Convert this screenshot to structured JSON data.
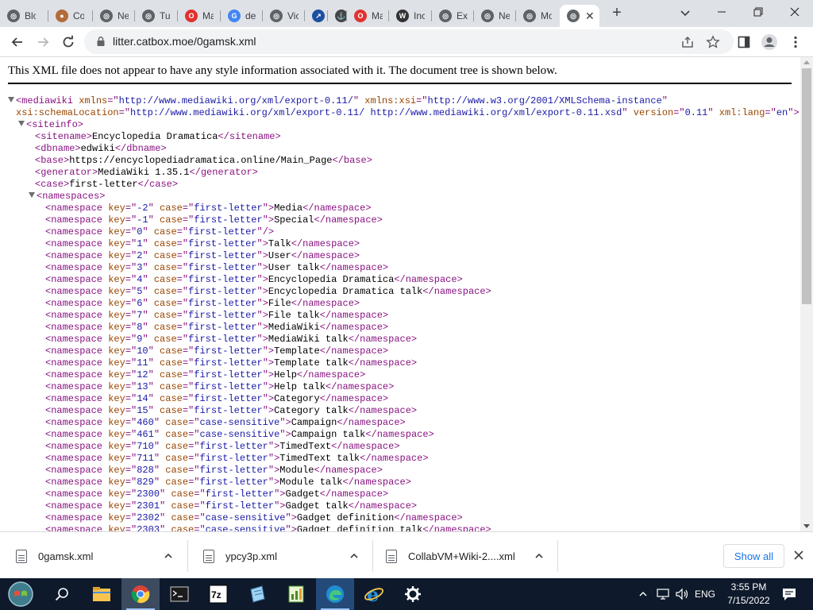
{
  "browser": {
    "tabs": [
      {
        "title": "Blc",
        "icon": "globe-icon"
      },
      {
        "title": "Co",
        "icon": "avatar-icon"
      },
      {
        "title": "Ne",
        "icon": "globe-icon"
      },
      {
        "title": "Tu",
        "icon": "globe-icon"
      },
      {
        "title": "Ma",
        "icon": "opera-red-icon"
      },
      {
        "title": "de",
        "icon": "google-icon"
      },
      {
        "title": "Vic",
        "icon": "globe-icon"
      },
      {
        "title": "",
        "icon": "bird-icon"
      },
      {
        "title": "",
        "icon": "anchor-icon"
      },
      {
        "title": "Ma",
        "icon": "opera-red-icon"
      },
      {
        "title": "Inc",
        "icon": "wikipedia-icon"
      },
      {
        "title": "Ex",
        "icon": "globe-icon"
      },
      {
        "title": "Ne",
        "icon": "globe-icon"
      },
      {
        "title": "Mo",
        "icon": "globe-icon"
      },
      {
        "title": "",
        "icon": "globe-icon",
        "active": true
      }
    ],
    "new_tab": "+",
    "url": "litter.catbox.moe/0gamsk.xml"
  },
  "page": {
    "notice": "This XML file does not appear to have any style information associated with it. The document tree is shown below.",
    "xml_lines": [
      {
        "indent": 0,
        "toggle": true,
        "parts": [
          [
            "tg",
            "<mediawiki"
          ],
          [
            "tx",
            " "
          ],
          [
            "an",
            "xmlns"
          ],
          [
            "tg",
            "=\""
          ],
          [
            "av",
            "http://www.mediawiki.org/xml/export-0.11/"
          ],
          [
            "tg",
            "\""
          ],
          [
            "tx",
            " "
          ],
          [
            "an",
            "xmlns:xsi"
          ],
          [
            "tg",
            "=\""
          ],
          [
            "av",
            "http://www.w3.org/2001/XMLSchema-instance"
          ],
          [
            "tg",
            "\""
          ]
        ]
      },
      {
        "indent": 0,
        "toggle": false,
        "offset": 20,
        "parts": [
          [
            "an",
            "xsi:schemaLocation"
          ],
          [
            "tg",
            "=\""
          ],
          [
            "av",
            "http://www.mediawiki.org/xml/export-0.11/ http://www.mediawiki.org/xml/export-0.11.xsd"
          ],
          [
            "tg",
            "\""
          ],
          [
            "tx",
            " "
          ],
          [
            "an",
            "version"
          ],
          [
            "tg",
            "=\""
          ],
          [
            "av",
            "0.11"
          ],
          [
            "tg",
            "\""
          ],
          [
            "tx",
            " "
          ],
          [
            "an",
            "xml:lang"
          ],
          [
            "tg",
            "=\""
          ],
          [
            "av",
            "en"
          ],
          [
            "tg",
            "\">"
          ]
        ]
      },
      {
        "indent": 1,
        "toggle": true,
        "parts": [
          [
            "tg",
            "<siteinfo>"
          ]
        ]
      },
      {
        "indent": 2,
        "parts": [
          [
            "tg",
            "<sitename>"
          ],
          [
            "tx",
            "Encyclopedia Dramatica"
          ],
          [
            "tg",
            "</sitename>"
          ]
        ]
      },
      {
        "indent": 2,
        "parts": [
          [
            "tg",
            "<dbname>"
          ],
          [
            "tx",
            "edwiki"
          ],
          [
            "tg",
            "</dbname>"
          ]
        ]
      },
      {
        "indent": 2,
        "parts": [
          [
            "tg",
            "<base>"
          ],
          [
            "tx",
            "https://encyclopediadramatica.online/Main_Page"
          ],
          [
            "tg",
            "</base>"
          ]
        ]
      },
      {
        "indent": 2,
        "parts": [
          [
            "tg",
            "<generator>"
          ],
          [
            "tx",
            "MediaWiki 1.35.1"
          ],
          [
            "tg",
            "</generator>"
          ]
        ]
      },
      {
        "indent": 2,
        "parts": [
          [
            "tg",
            "<case>"
          ],
          [
            "tx",
            "first-letter"
          ],
          [
            "tg",
            "</case>"
          ]
        ]
      },
      {
        "indent": 2,
        "toggle": true,
        "parts": [
          [
            "tg",
            "<namespaces>"
          ]
        ]
      }
    ],
    "namespaces": [
      {
        "key": "-2",
        "case": "first-letter",
        "name": "Media"
      },
      {
        "key": "-1",
        "case": "first-letter",
        "name": "Special"
      },
      {
        "key": "0",
        "case": "first-letter",
        "name": null
      },
      {
        "key": "1",
        "case": "first-letter",
        "name": "Talk"
      },
      {
        "key": "2",
        "case": "first-letter",
        "name": "User"
      },
      {
        "key": "3",
        "case": "first-letter",
        "name": "User talk"
      },
      {
        "key": "4",
        "case": "first-letter",
        "name": "Encyclopedia Dramatica"
      },
      {
        "key": "5",
        "case": "first-letter",
        "name": "Encyclopedia Dramatica talk"
      },
      {
        "key": "6",
        "case": "first-letter",
        "name": "File"
      },
      {
        "key": "7",
        "case": "first-letter",
        "name": "File talk"
      },
      {
        "key": "8",
        "case": "first-letter",
        "name": "MediaWiki"
      },
      {
        "key": "9",
        "case": "first-letter",
        "name": "MediaWiki talk"
      },
      {
        "key": "10",
        "case": "first-letter",
        "name": "Template"
      },
      {
        "key": "11",
        "case": "first-letter",
        "name": "Template talk"
      },
      {
        "key": "12",
        "case": "first-letter",
        "name": "Help"
      },
      {
        "key": "13",
        "case": "first-letter",
        "name": "Help talk"
      },
      {
        "key": "14",
        "case": "first-letter",
        "name": "Category"
      },
      {
        "key": "15",
        "case": "first-letter",
        "name": "Category talk"
      },
      {
        "key": "460",
        "case": "case-sensitive",
        "name": "Campaign"
      },
      {
        "key": "461",
        "case": "case-sensitive",
        "name": "Campaign talk"
      },
      {
        "key": "710",
        "case": "first-letter",
        "name": "TimedText"
      },
      {
        "key": "711",
        "case": "first-letter",
        "name": "TimedText talk"
      },
      {
        "key": "828",
        "case": "first-letter",
        "name": "Module"
      },
      {
        "key": "829",
        "case": "first-letter",
        "name": "Module talk"
      },
      {
        "key": "2300",
        "case": "first-letter",
        "name": "Gadget"
      },
      {
        "key": "2301",
        "case": "first-letter",
        "name": "Gadget talk"
      },
      {
        "key": "2302",
        "case": "case-sensitive",
        "name": "Gadget definition"
      },
      {
        "key": "2303",
        "case": "case-sensitive",
        "name": "Gadget definition talk"
      }
    ]
  },
  "downloads": {
    "items": [
      {
        "name": "0gamsk.xml"
      },
      {
        "name": "ypcy3p.xml"
      },
      {
        "name": "CollabVM+Wiki-2....xml"
      }
    ],
    "show_all": "Show all"
  },
  "taskbar": {
    "apps": [
      "start-orb-icon",
      "search-icon",
      "file-explorer-icon",
      "chrome-icon",
      "terminal-icon",
      "7zip-icon",
      "notepad-icon",
      "spreadsheet-icon",
      "edge-icon",
      "internet-explorer-icon",
      "settings-icon"
    ],
    "language": "ENG",
    "time": "3:55 PM",
    "date": "7/15/2022"
  },
  "colors": {
    "tag": "#881280",
    "attr_name": "#994500",
    "attr_value": "#1a1aa6",
    "tab_strip": "#dee1e6",
    "taskbar": "#0e1a2b",
    "accent": "#1a73e8"
  }
}
